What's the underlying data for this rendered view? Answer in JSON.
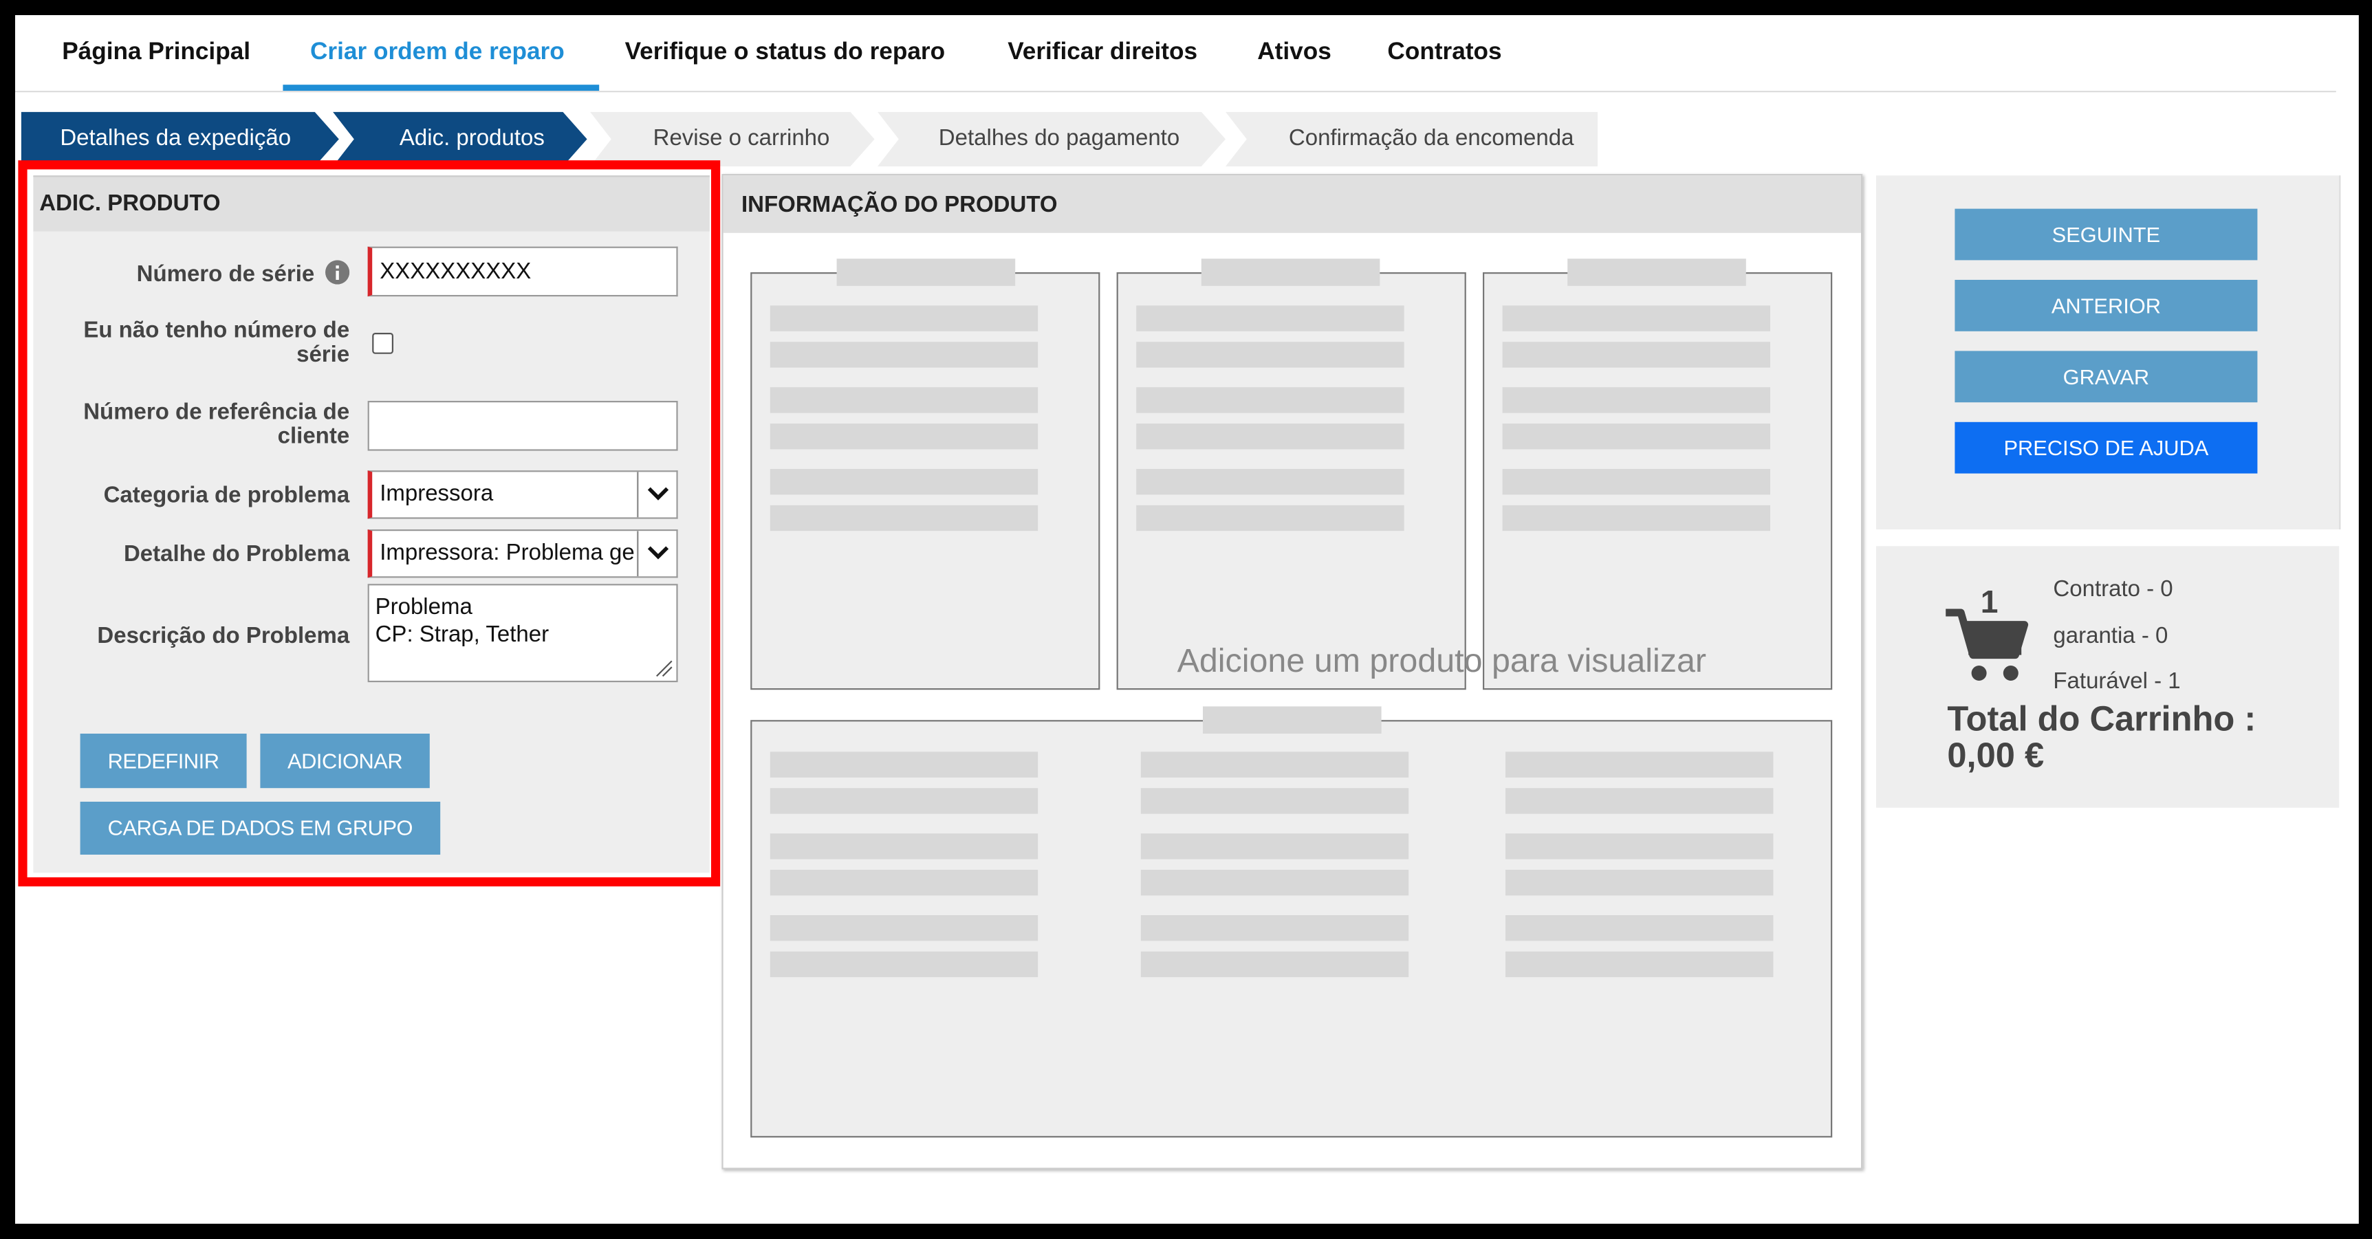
{
  "nav": {
    "items": [
      "Página Principal",
      "Criar ordem de reparo",
      "Verifique o status do reparo",
      "Verificar direitos",
      "Ativos",
      "Contratos"
    ],
    "active": "Criar ordem de reparo",
    "accent": "#1e8ed6"
  },
  "steps": [
    {
      "label": "Detalhes da expedição",
      "state": "done"
    },
    {
      "label": "Adic. produtos",
      "state": "current"
    },
    {
      "label": "Revise o carrinho",
      "state": "pending"
    },
    {
      "label": "Detalhes do pagamento",
      "state": "pending"
    },
    {
      "label": "Confirmação da encomenda",
      "state": "pending"
    }
  ],
  "add_product": {
    "title": "ADIC. PRODUTO",
    "serial_label": "Número de série",
    "serial_value": "XXXXXXXXXX",
    "no_serial_label": "Eu não tenho número de série",
    "no_serial_checked": false,
    "customer_ref_label": "Número de referência de cliente",
    "customer_ref_value": "",
    "category_label": "Categoria de problema",
    "category_value": "Impressora",
    "detail_label": "Detalhe do Problema",
    "detail_value": "Impressora: Problema ge",
    "description_label": "Descrição do Problema",
    "description_value": "Problema\nCP: Strap, Tether",
    "reset_label": "REDEFINIR",
    "add_label": "ADICIONAR",
    "bulk_label": "CARGA DE DADOS EM GRUPO",
    "required_color": "#d7262b",
    "highlight_color": "#ff0000"
  },
  "product_info": {
    "title": "INFORMAÇÃO DO PRODUTO",
    "placeholder": "Adicione um produto para visualizar"
  },
  "actions": {
    "next_label": "SEGUINTE",
    "previous_label": "ANTERIOR",
    "save_label": "GRAVAR",
    "help_label": "PRECISO DE AJUDA",
    "button_color": "#5b9ec9",
    "help_color": "#0d6ef2"
  },
  "cart": {
    "count": "1",
    "contract_line": "Contrato - 0",
    "warranty_line": "garantia - 0",
    "billable_line": "Faturável - 1",
    "total_label": "Total do Carrinho :",
    "total_value": "0,00 €"
  }
}
